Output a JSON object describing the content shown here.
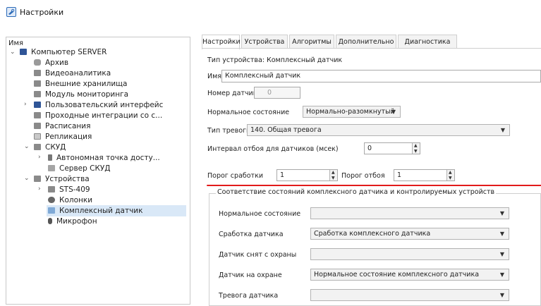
{
  "window": {
    "title": "Настройки"
  },
  "tree": {
    "header": "Имя",
    "items": [
      {
        "label": "Компьютер SERVER"
      },
      {
        "label": "Архив"
      },
      {
        "label": "Видеоаналитика"
      },
      {
        "label": "Внешние хранилища"
      },
      {
        "label": "Модуль мониторинга"
      },
      {
        "label": "Пользовательский интерфейс"
      },
      {
        "label": "Проходные интеграции со с..."
      },
      {
        "label": "Расписания"
      },
      {
        "label": "Репликация"
      },
      {
        "label": "СКУД"
      },
      {
        "label": "Автономная точка досту..."
      },
      {
        "label": "Сервер СКУД"
      },
      {
        "label": "Устройства"
      },
      {
        "label": "STS-409"
      },
      {
        "label": "Колонки"
      },
      {
        "label": "Комплексный датчик"
      },
      {
        "label": "Микрофон"
      }
    ]
  },
  "tabs": [
    "Настройки",
    "Устройства",
    "Алгоритмы",
    "Дополнительно",
    "Диагностика"
  ],
  "form": {
    "device_type": "Тип устройства: Комплексный датчик",
    "name_label": "Имя",
    "name_value": "Комплексный датчик",
    "sensor_number_label": "Номер датчика",
    "sensor_number_value": "0",
    "normal_state_label": "Нормальное состояние",
    "normal_state_value": "Нормально-разомкнутый",
    "alarm_type_label": "Тип тревоги",
    "alarm_type_value": "140. Общая тревога",
    "interval_label": "Интервал отбоя для датчиков (мсек)",
    "interval_value": "0",
    "trigger_threshold_label": "Порог сработки",
    "trigger_threshold_value": "1",
    "reset_threshold_label": "Порог отбоя",
    "reset_threshold_value": "1"
  },
  "group": {
    "title": "Соответствие состояний комплексного датчика и контролируемых устройств",
    "rows": [
      {
        "label": "Нормальное состояние",
        "value": ""
      },
      {
        "label": "Сработка датчика",
        "value": "Сработка комплексного датчика"
      },
      {
        "label": "Датчик снят с охраны",
        "value": ""
      },
      {
        "label": "Датчик на охране",
        "value": "Нормальное состояние комплексного датчика"
      },
      {
        "label": "Тревога датчика",
        "value": ""
      }
    ]
  },
  "colors": {
    "highlight": "#e21b1b",
    "selection": "#d9e8f7",
    "accent": "#2b6ab8"
  }
}
